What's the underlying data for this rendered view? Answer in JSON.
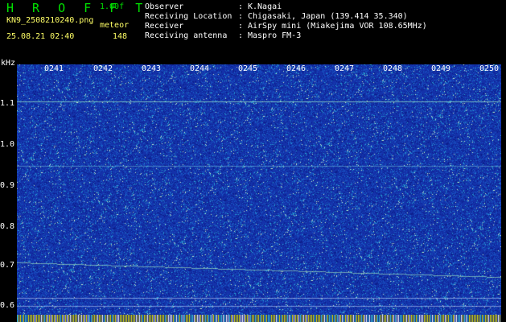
{
  "app": {
    "title": "H R O F F T",
    "version": "1.00f",
    "filename": "KN9_2508210240.png",
    "mode": "meteor",
    "timestamp": "25.08.21 02:40",
    "count": "148"
  },
  "meta": [
    {
      "label": "Observer",
      "value": "K.Nagai"
    },
    {
      "label": "Receiving Location",
      "value": "Chigasaki, Japan (139.414 35.340)"
    },
    {
      "label": "Receiver",
      "value": "AirSpy mini (Miakejima VOR 108.65MHz)"
    },
    {
      "label": "Receiving antenna",
      "value": "Maspro FM-3"
    }
  ],
  "axis": {
    "y_unit": "kHz",
    "y_ticks": [
      "1.1",
      "1.0",
      "0.9",
      "0.8",
      "0.7",
      "0.6"
    ],
    "x_ticks": [
      "0241",
      "0242",
      "0243",
      "0244",
      "0245",
      "0246",
      "0247",
      "0248",
      "0249",
      "0250"
    ]
  },
  "colors": {
    "background": "#000000",
    "plot_bg": "#1a38b0",
    "title_green": "#00e000",
    "label_yellow": "#ffff66",
    "text_white": "#ffffff"
  }
}
